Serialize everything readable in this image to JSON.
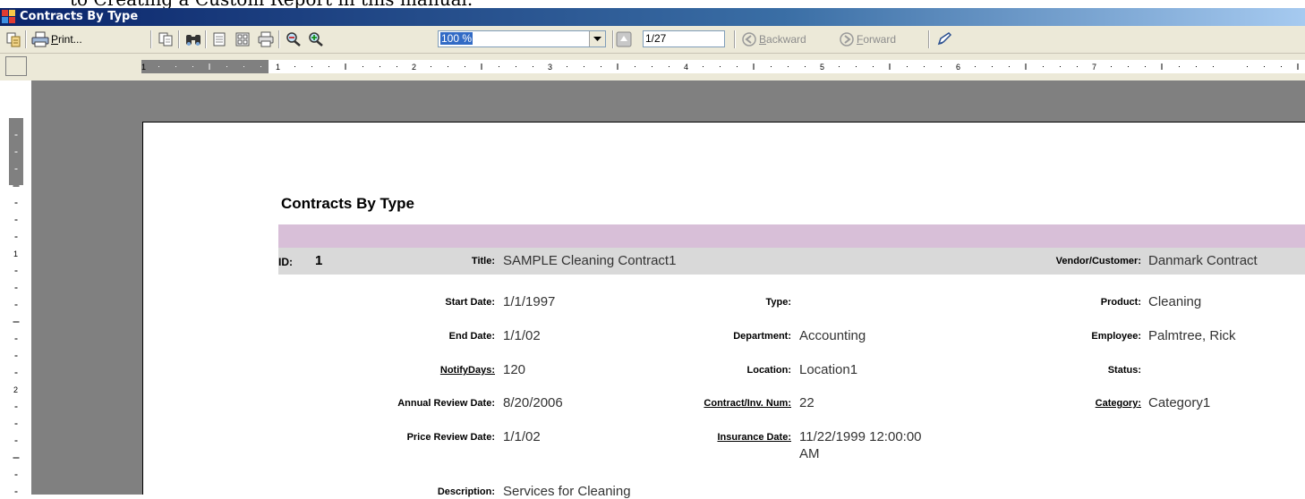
{
  "document": {
    "text_above_window": "to Creating a Custom Report in this manual."
  },
  "window": {
    "title": "Contracts By Type"
  },
  "toolbar": {
    "print_label": "Print...",
    "print_accesskey": "P",
    "zoom_value": "100 %",
    "page_value": "1/27",
    "backward_label": "Backward",
    "forward_label": "Forward",
    "icons": [
      "export-icon",
      "printer-icon",
      "copy-icon",
      "find-binoculars-icon",
      "single-page-icon",
      "multi-page-icon",
      "page-setup-icon",
      "zoom-out-icon",
      "zoom-in-icon",
      "previous-page-icon",
      "next-page-icon",
      "backward-icon",
      "forward-icon",
      "edit-pen-icon"
    ]
  },
  "ruler": {
    "h_numbers": [
      "1",
      "1",
      "2",
      "3",
      "4",
      "5",
      "6",
      "7"
    ],
    "v_numbers": [
      "1",
      "2"
    ]
  },
  "report": {
    "title": "Contracts By Type",
    "record": {
      "id_label": "ID:",
      "id_value": "1",
      "title_label": "Title:",
      "title_value": "SAMPLE Cleaning Contract1",
      "vendor_label": "Vendor/Customer:",
      "vendor_value": "Danmark Contract",
      "start_date_label": "Start Date:",
      "start_date_value": "1/1/1997",
      "end_date_label": "End Date:",
      "end_date_value": "1/1/02",
      "notify_days_label": "NotifyDays:",
      "notify_days_value": "120",
      "annual_review_label": "Annual Review Date:",
      "annual_review_value": "8/20/2006",
      "price_review_label": "Price Review Date:",
      "price_review_value": "1/1/02",
      "description_label": "Description:",
      "description_value": "Services for Cleaning",
      "type_label": "Type:",
      "type_value": "",
      "department_label": "Department:",
      "department_value": "Accounting",
      "location_label": "Location:",
      "location_value": "Location1",
      "contract_num_label": "Contract/Inv. Num:",
      "contract_num_value": "22",
      "insurance_date_label": "Insurance Date:",
      "insurance_date_value_line1": "11/22/1999 12:00:00",
      "insurance_date_value_line2": "AM",
      "product_label": "Product:",
      "product_value": "Cleaning",
      "employee_label": "Employee:",
      "employee_value": "Palmtree, Rick",
      "status_label": "Status:",
      "status_value": "",
      "category_label": "Category:",
      "category_value": "Category1"
    }
  },
  "colors": {
    "titlebar_start": "#0a246a",
    "titlebar_end": "#a6caf0",
    "toolbar_bg": "#ece9d8",
    "band_purple": "#d8bfd8",
    "band_grey": "#d9d9d9",
    "viewport_bg": "#808080"
  }
}
